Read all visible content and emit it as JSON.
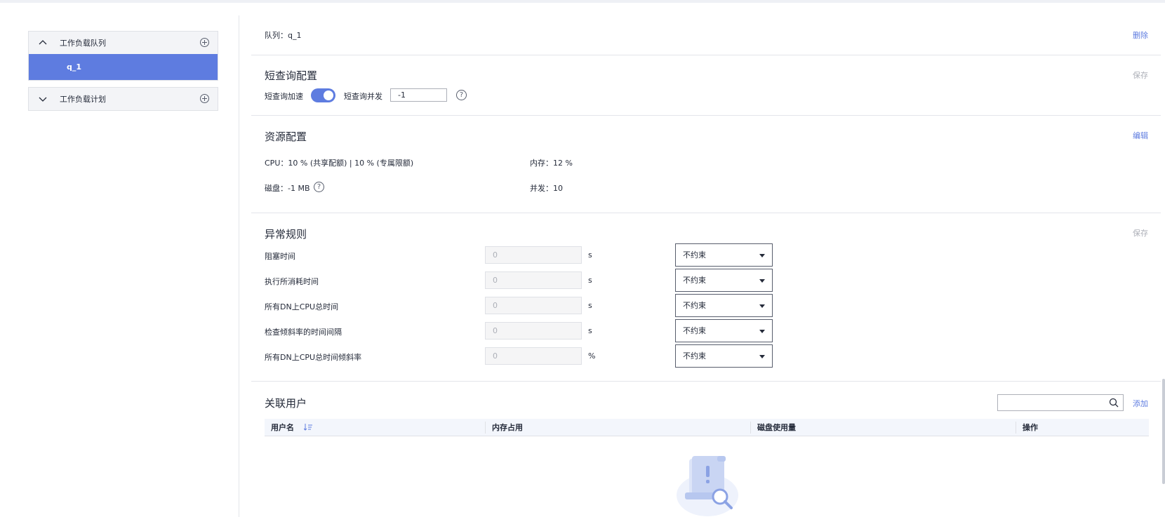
{
  "sidebar": {
    "groups": [
      {
        "label": "工作负载队列",
        "expanded": true,
        "icon": "chevron-up-icon",
        "items": [
          {
            "label": "q_1",
            "selected": true
          }
        ]
      },
      {
        "label": "工作负载计划",
        "expanded": false,
        "icon": "chevron-down-icon",
        "items": []
      }
    ]
  },
  "queue": {
    "label": "队列：",
    "name": "q_1",
    "delete_label": "删除"
  },
  "short_query": {
    "title": "短查询配置",
    "save_label": "保存",
    "accel_label": "短查询加速",
    "accel_enabled": true,
    "concurrency_label": "短查询并发",
    "concurrency_value": "-1",
    "help_glyph": "?"
  },
  "resource": {
    "title": "资源配置",
    "edit_label": "编辑",
    "cpu_label": "CPU：",
    "cpu_value": "10 % (共享配额) | 10 % (专属限额)",
    "memory_label": "内存：",
    "memory_value": "12 %",
    "disk_label": "磁盘：",
    "disk_value": "-1 MB",
    "concurrency_label": "并发：",
    "concurrency_value": "10",
    "help_glyph": "?"
  },
  "exception_rules": {
    "title": "异常规则",
    "save_label": "保存",
    "rows": [
      {
        "label": "阻塞时间",
        "value": "0",
        "unit": "s",
        "action": "不约束"
      },
      {
        "label": "执行所消耗时间",
        "value": "0",
        "unit": "s",
        "action": "不约束"
      },
      {
        "label": "所有DN上CPU总时间",
        "value": "0",
        "unit": "s",
        "action": "不约束"
      },
      {
        "label": "检查倾斜率的时间间隔",
        "value": "0",
        "unit": "s",
        "action": "不约束"
      },
      {
        "label": "所有DN上CPU总时间倾斜率",
        "value": "0",
        "unit": "%",
        "action": "不约束"
      }
    ]
  },
  "users": {
    "title": "关联用户",
    "add_label": "添加",
    "search_placeholder": "",
    "columns": [
      "用户名",
      "内存占用",
      "磁盘使用量",
      "操作"
    ],
    "rows": []
  },
  "colors": {
    "accent": "#5e7ce0",
    "text": "#252b3a",
    "muted": "#adb0b8"
  }
}
